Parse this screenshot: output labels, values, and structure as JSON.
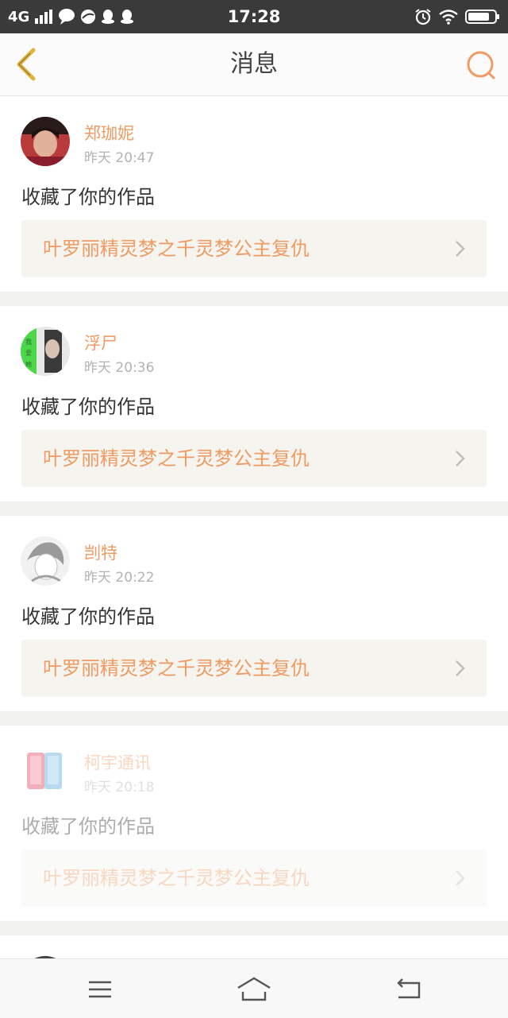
{
  "status_bar": {
    "network": "4G",
    "time": "17:28",
    "icons": [
      "signal-icon",
      "chat-bubble-icon",
      "browser-icon",
      "qq-icon",
      "qq-icon",
      "alarm-icon",
      "wifi-icon",
      "battery-icon"
    ]
  },
  "header": {
    "title": "消息",
    "back_icon": "chevron-left-icon",
    "search_icon": "search-icon"
  },
  "colors": {
    "accent": "#ef9b63",
    "back_icon": "#e0b33a",
    "card_bg": "#ffffff",
    "work_bg": "#f5f4ef",
    "page_bg": "#f2f2f0"
  },
  "messages": [
    {
      "name": "郑珈妮",
      "time": "昨天 20:47",
      "action": "收藏了你的作品",
      "work_title": "叶罗丽精灵梦之千灵梦公主复仇"
    },
    {
      "name": "浮尸",
      "time": "昨天 20:36",
      "action": "收藏了你的作品",
      "work_title": "叶罗丽精灵梦之千灵梦公主复仇"
    },
    {
      "name": "剀特",
      "time": "昨天 20:22",
      "action": "收藏了你的作品",
      "work_title": "叶罗丽精灵梦之千灵梦公主复仇"
    },
    {
      "name": "柯宇通讯",
      "time": "昨天 20:18",
      "action": "收藏了你的作品",
      "work_title": "叶罗丽精灵梦之千灵梦公主复仇"
    }
  ],
  "nav_bar": {
    "menu_icon": "menu-icon",
    "home_icon": "home-icon",
    "back_icon": "back-icon"
  }
}
